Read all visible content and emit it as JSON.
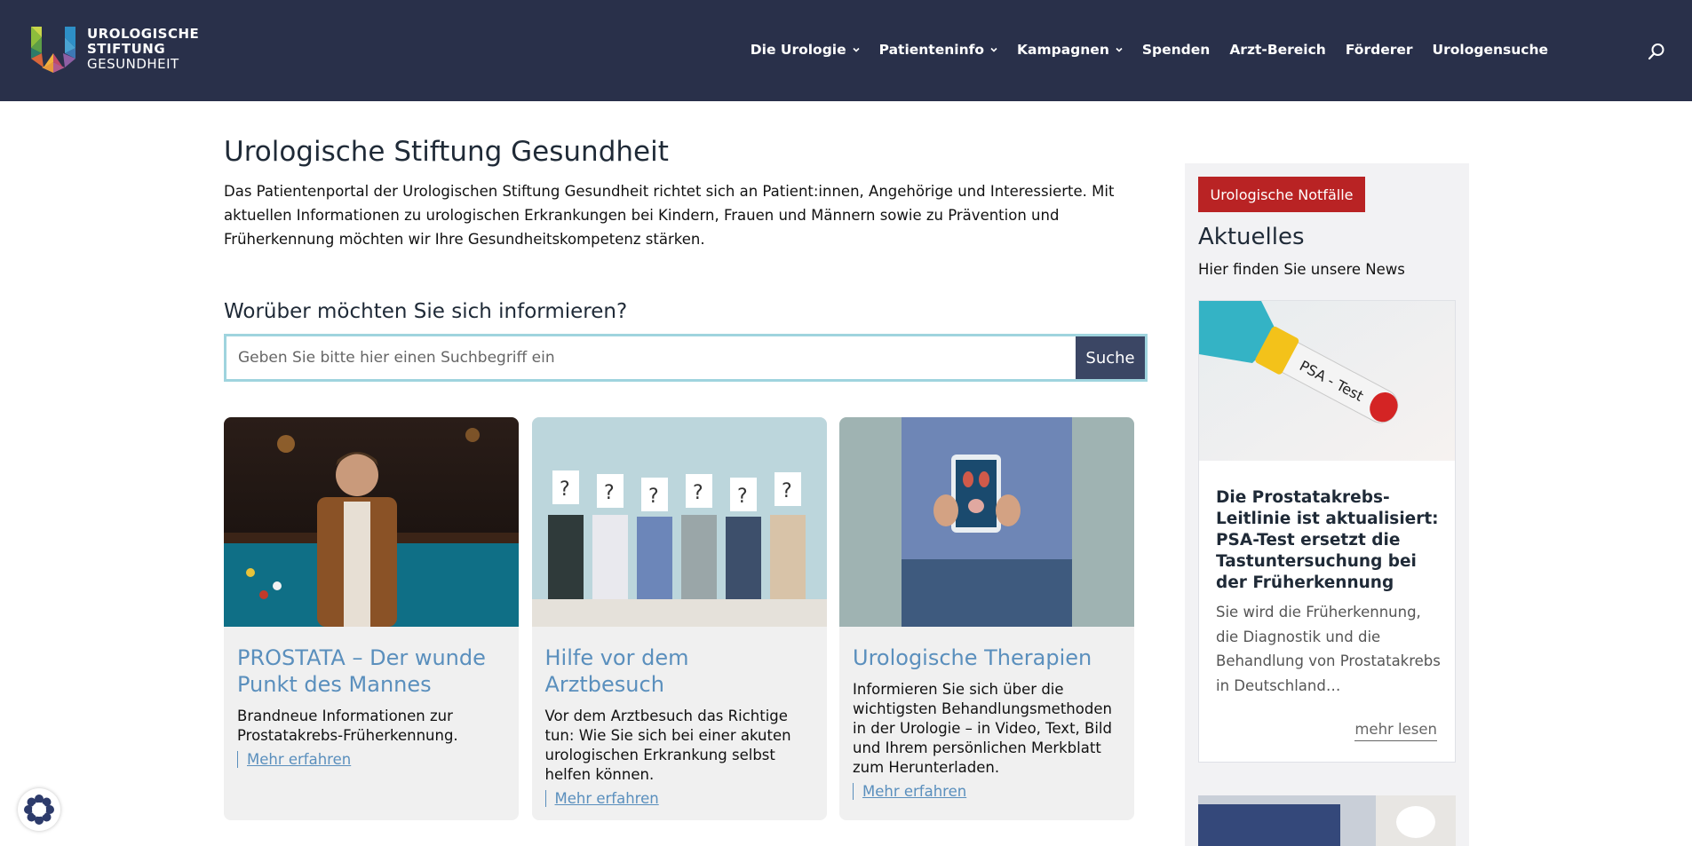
{
  "brand": {
    "line1": "UROLOGISCHE",
    "line2": "STIFTUNG",
    "line3": "GESUNDHEIT"
  },
  "nav": {
    "items": [
      {
        "label": "Die Urologie",
        "has_dropdown": true
      },
      {
        "label": "Patienteninfo",
        "has_dropdown": true
      },
      {
        "label": "Kampagnen",
        "has_dropdown": true
      },
      {
        "label": "Spenden",
        "has_dropdown": false
      },
      {
        "label": "Arzt-Bereich",
        "has_dropdown": false
      },
      {
        "label": "Förderer",
        "has_dropdown": false
      },
      {
        "label": "Urologensuche",
        "has_dropdown": false
      }
    ],
    "search_icon": "search-icon"
  },
  "main": {
    "title": "Urologische Stiftung Gesundheit",
    "intro": "Das Patientenportal der Urologischen Stiftung Gesundheit richtet sich an Patient:innen, Angehörige und Interessierte. Mit aktuellen Informationen zu urologischen Erkrankungen bei Kindern, Frauen und Männern sowie zu Prävention und Früherkennung möchten wir Ihre Gesundheitskompetenz stärken.",
    "search_heading": "Worüber möchten Sie sich informieren?",
    "search_placeholder": "Geben Sie bitte hier einen Suchbegriff ein",
    "search_value": "",
    "search_button": "Suche"
  },
  "cards": [
    {
      "title": "PROSTATA – Der wunde Punkt des Mannes",
      "text": "Brandneue Informationen zur Prostatakrebs-Früherkennung.",
      "link": "Mehr erfahren"
    },
    {
      "title": "Hilfe vor dem Arztbesuch",
      "text": "Vor dem Arztbesuch das Richtige tun: Wie Sie sich bei einer akuten urologischen Erkrankung selbst helfen können.",
      "link": "Mehr erfahren"
    },
    {
      "title": "Urologische Therapien",
      "text": "Informieren Sie sich über die wichtigsten Behandlungsmethoden in der Urologie – in Video, Text, Bild und Ihrem persönlichen Merkblatt zum Herunterladen.",
      "link": "Mehr erfahren"
    }
  ],
  "sidebar": {
    "emergency_button": "Urologische Notfälle",
    "title": "Aktuelles",
    "subtitle": "Hier finden Sie unsere News",
    "news": {
      "image_label": "PSA - Test",
      "title": "Die Prostatakrebs-Leitlinie ist aktualisiert: PSA-Test ersetzt die Tastuntersuchung bei der Früherkennung",
      "excerpt": "Sie wird die Früherkennung, die Diagnostik und die Behandlung von Prostatakrebs in Deutschland…",
      "more": "mehr lesen"
    }
  },
  "colors": {
    "header_bg": "#29304a",
    "accent_blue": "#5a8fbd",
    "emergency_red": "#b92324",
    "search_button_bg": "#3b4664",
    "search_border": "#9fd4de"
  }
}
